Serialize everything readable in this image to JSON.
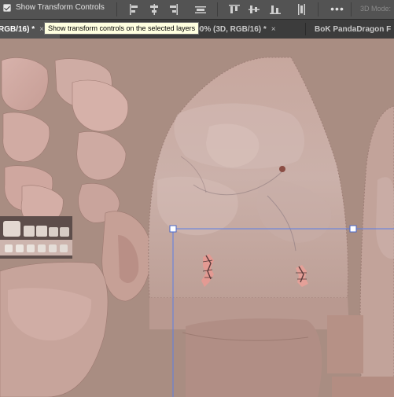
{
  "options_bar": {
    "show_transform_label": "Show Transform Controls",
    "show_transform_checked": true,
    "more_label": "•••",
    "mode_3d_label": "3D Mode:",
    "icons": [
      "align-left-edges-icon",
      "align-horizontal-centers-icon",
      "align-right-edges-icon",
      "distribute-horizontal-icon",
      "align-top-edges-icon",
      "align-vertical-centers-icon",
      "align-bottom-edges-icon",
      "distribute-vertical-icon"
    ]
  },
  "tooltip": {
    "text": "Show transform controls on the selected layers"
  },
  "tabs": [
    {
      "label": "RGB/16) *",
      "close": "×",
      "active": true
    },
    {
      "label": "Warrom Scars Normal Kit.psd @ 100% (3D, RGB/16) *",
      "close": "×",
      "active": false
    },
    {
      "label": "BoK PandaDragon F",
      "close": "",
      "active": false
    }
  ],
  "canvas": {
    "content": "uv-texture-skin",
    "selection_color": "#5b7ee6"
  }
}
